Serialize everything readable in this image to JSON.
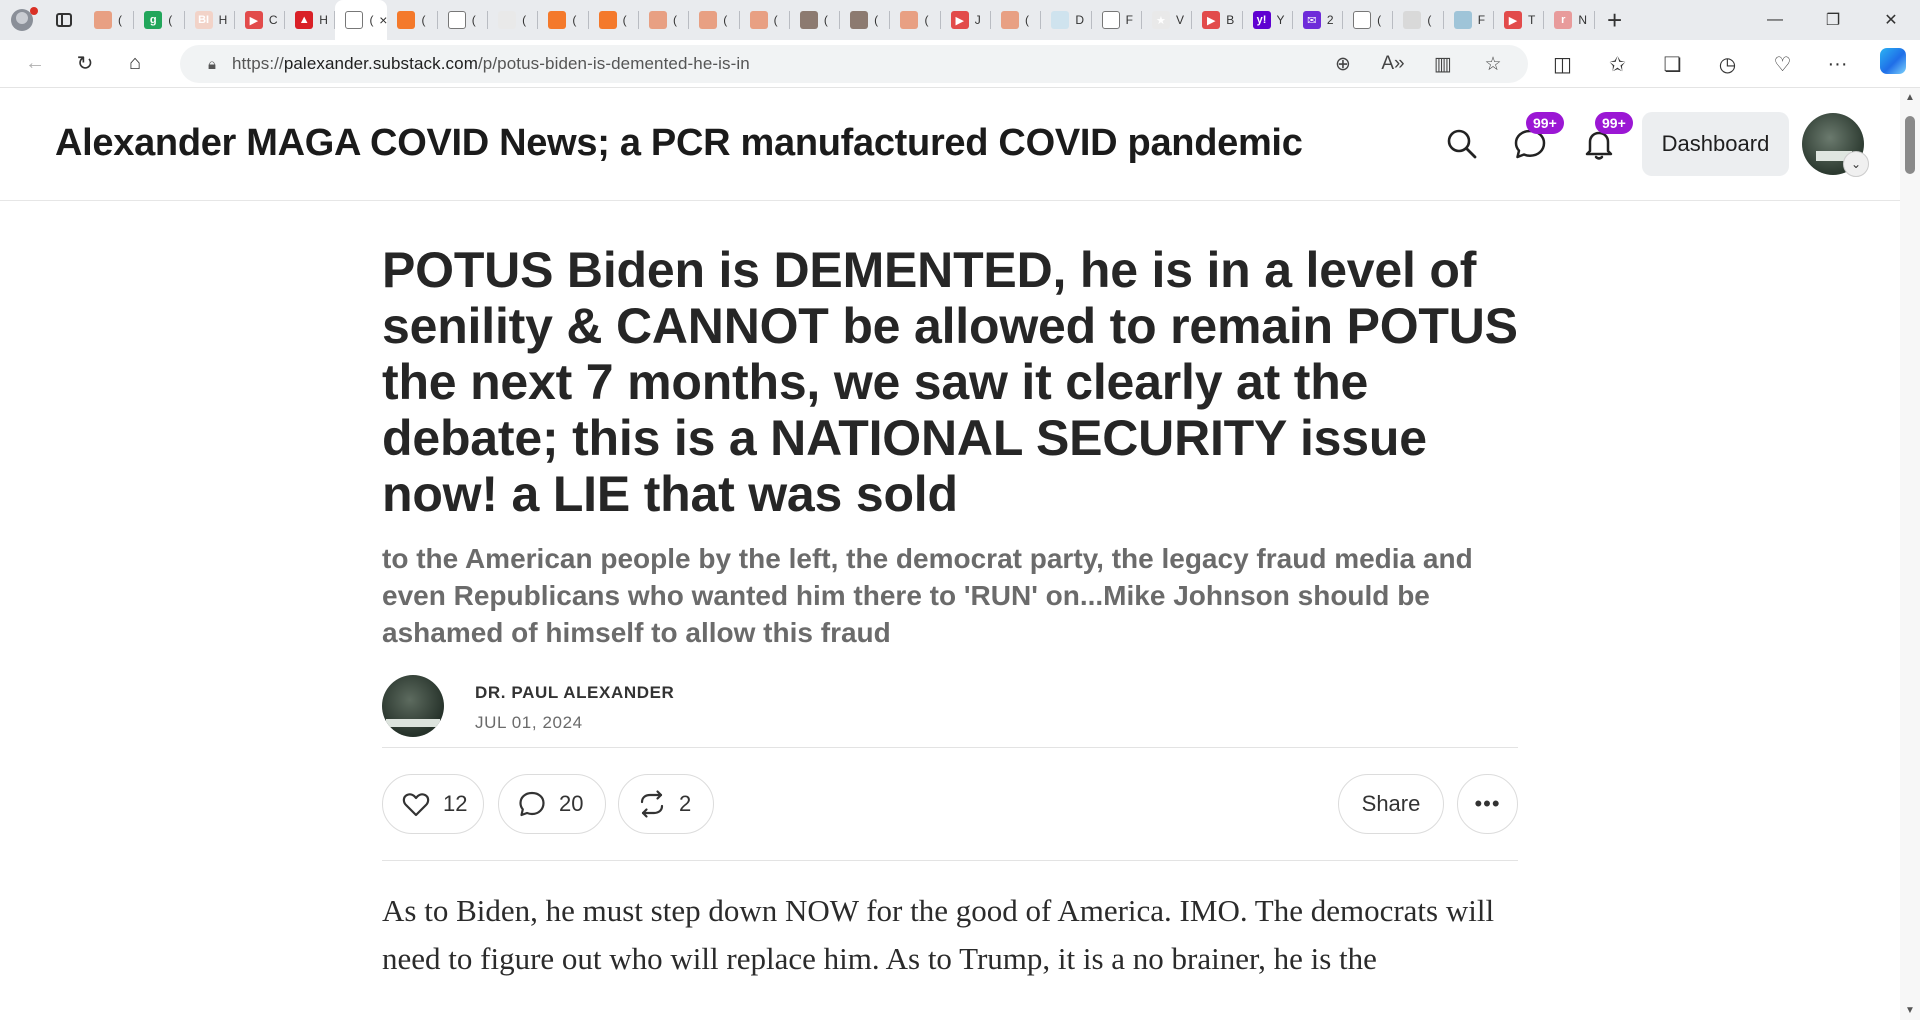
{
  "browser": {
    "url_prefix": "https://",
    "url_domain": "palexander.substack.com",
    "url_path": "/p/potus-biden-is-demented-he-is-in",
    "active_tab_close": "×",
    "tabs": [
      {
        "glyph": "",
        "color": "#e8a083",
        "letter": "("
      },
      {
        "glyph": "g",
        "color": "#22a65b",
        "letter": "("
      },
      {
        "glyph": "BI",
        "color": "#f2d3c8",
        "letter": "H"
      },
      {
        "glyph": "▶",
        "color": "#e24b4b",
        "letter": "C"
      },
      {
        "glyph": "▲",
        "color": "#d92027",
        "letter": "H"
      },
      {
        "glyph": "",
        "color": "#ffffff",
        "letter": "("
      },
      {
        "glyph": "",
        "color": "#f4792b",
        "letter": "("
      },
      {
        "glyph": "",
        "color": "#ffffff",
        "letter": "("
      },
      {
        "glyph": "",
        "color": "#e9e9e9",
        "letter": "("
      },
      {
        "glyph": "",
        "color": "#f4792b",
        "letter": "("
      },
      {
        "glyph": "",
        "color": "#f4792b",
        "letter": "("
      },
      {
        "glyph": "",
        "color": "#e8a083",
        "letter": "("
      },
      {
        "glyph": "",
        "color": "#e8a083",
        "letter": "("
      },
      {
        "glyph": "",
        "color": "#e8a083",
        "letter": "("
      },
      {
        "glyph": "",
        "color": "#8c7a70",
        "letter": "("
      },
      {
        "glyph": "",
        "color": "#8c7a70",
        "letter": "("
      },
      {
        "glyph": "",
        "color": "#e8a083",
        "letter": "("
      },
      {
        "glyph": "▶",
        "color": "#e24b4b",
        "letter": "J"
      },
      {
        "glyph": "",
        "color": "#e8a083",
        "letter": "("
      },
      {
        "glyph": "",
        "color": "#cfe3ee",
        "letter": "D"
      },
      {
        "glyph": "",
        "color": "#ffffff",
        "letter": "F"
      },
      {
        "glyph": "★",
        "color": "#e9e9e9",
        "letter": "V"
      },
      {
        "glyph": "▶",
        "color": "#e24b4b",
        "letter": "B"
      },
      {
        "glyph": "y!",
        "color": "#5f01d1",
        "letter": "Y"
      },
      {
        "glyph": "✉",
        "color": "#6e2bd9",
        "letter": "2"
      },
      {
        "glyph": "",
        "color": "#ffffff",
        "letter": "("
      },
      {
        "glyph": "",
        "color": "#d9d9d9",
        "letter": "("
      },
      {
        "glyph": "",
        "color": "#9fc4d8",
        "letter": "F"
      },
      {
        "glyph": "▶",
        "color": "#e24b4b",
        "letter": "T"
      },
      {
        "glyph": "r",
        "color": "#e89b9b",
        "letter": "N"
      }
    ],
    "active_tab_index": 5
  },
  "header": {
    "site_title": "Alexander MAGA COVID News; a PCR manufactured COVID pandemic",
    "messages_badge": "99+",
    "notifications_badge": "99+",
    "dashboard_label": "Dashboard"
  },
  "post": {
    "title": "POTUS Biden is DEMENTED, he is in a level of senility & CANNOT be allowed to remain POTUS the next 7 months, we saw it clearly at the debate; this is a NATIONAL SECURITY issue now! a LIE that was sold",
    "subtitle": "to the American people by the left, the democrat party, the legacy fraud media and even Republicans who wanted him there to 'RUN' on...Mike Johnson should be ashamed of himself to allow this fraud",
    "author": "DR. PAUL ALEXANDER",
    "date": "JUL 01, 2024",
    "likes": "12",
    "comments": "20",
    "restacks": "2",
    "share_label": "Share",
    "more_label": "•••",
    "body_start": "As to Biden, he must step down NOW for the good of America. IMO. The democrats will need to figure out who will replace him. As to Trump, it is a no brainer, he is the"
  },
  "colors": {
    "badge": "#9b17d4",
    "title_text": "#262626",
    "subtitle_text": "#6b6b6b"
  }
}
